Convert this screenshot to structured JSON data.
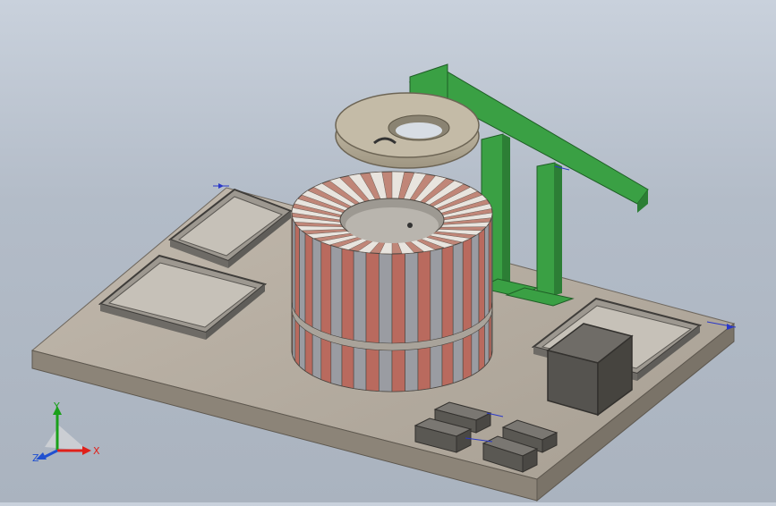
{
  "viewport": {
    "triad": {
      "x_label": "X",
      "y_label": "Y",
      "z_label": "Z",
      "x_color": "#e0201a",
      "y_color": "#1aa01a",
      "z_color": "#2050d0"
    },
    "colors": {
      "background": "#b7c0cc",
      "platform_top": "#b9b0a3",
      "platform_side": "#8c8478",
      "brick": "#b96a5e",
      "brick_light": "#d7cfc4",
      "steel_gray": "#8e9095",
      "frame_green": "#3aa044",
      "tray_gray": "#7f7d78",
      "tire": "#b9b09d"
    },
    "icons": [
      "triad-icon",
      "dimension-arrow-icon"
    ]
  }
}
